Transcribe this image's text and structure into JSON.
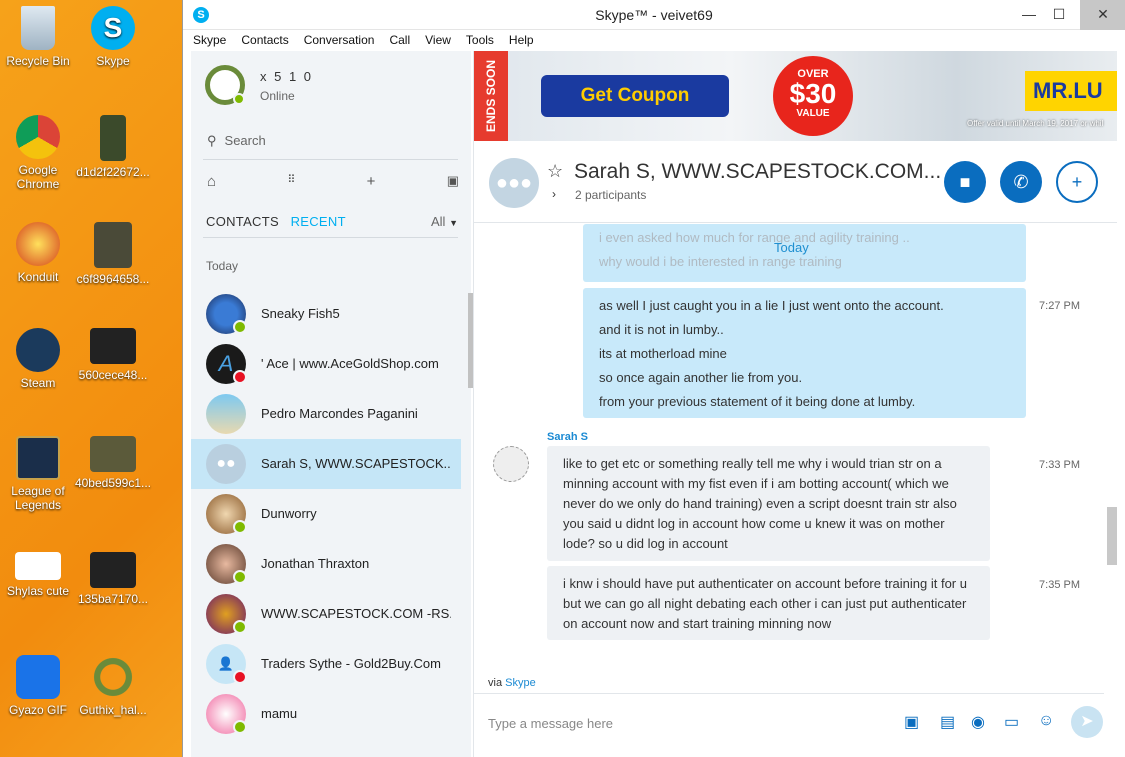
{
  "desktop": {
    "icons": [
      {
        "label": "Recycle Bin"
      },
      {
        "label": "Skype"
      },
      {
        "label": "Google Chrome"
      },
      {
        "label": "d1d2f22672..."
      },
      {
        "label": "Konduit"
      },
      {
        "label": "c6f8964658..."
      },
      {
        "label": "Steam"
      },
      {
        "label": "560cece48..."
      },
      {
        "label": "League of Legends"
      },
      {
        "label": "40bed599c1..."
      },
      {
        "label": "Shylas cute"
      },
      {
        "label": "135ba7170..."
      },
      {
        "label": "Gyazo GIF"
      },
      {
        "label": "Guthix_hal..."
      }
    ]
  },
  "window": {
    "title": "Skype™ - veivet69",
    "minimize": "—",
    "maximize": "☐",
    "close": "✕"
  },
  "menu": [
    "Skype",
    "Contacts",
    "Conversation",
    "Call",
    "View",
    "Tools",
    "Help"
  ],
  "profile": {
    "name": "x 5 1 0",
    "status": "Online"
  },
  "search": {
    "placeholder": "Search"
  },
  "tabs": {
    "contacts": "CONTACTS",
    "recent": "RECENT",
    "filter": "All"
  },
  "section": "Today",
  "contacts": [
    {
      "name": "Sneaky Fish5",
      "presence": "on"
    },
    {
      "name": "' Ace | www.AceGoldShop.com",
      "presence": "off"
    },
    {
      "name": "Pedro Marcondes Paganini",
      "presence": "none"
    },
    {
      "name": "Sarah S, WWW.SCAPESTOCK....",
      "presence": "group"
    },
    {
      "name": "Dunworry",
      "presence": "on"
    },
    {
      "name": "Jonathan Thraxton",
      "presence": "on"
    },
    {
      "name": "WWW.SCAPESTOCK.COM -RS...",
      "presence": "on"
    },
    {
      "name": "Traders Sythe - Gold2Buy.Com",
      "presence": "off"
    },
    {
      "name": "mamu",
      "presence": "on"
    }
  ],
  "ad": {
    "ends": "ENDS SOON",
    "button": "Get Coupon",
    "over": "OVER",
    "amount": "$30",
    "value": "VALUE",
    "brand": "MR.LU",
    "offer": "Offer valid until March 19, 2017 or whil"
  },
  "conversation": {
    "title": "Sarah S, WWW.SCAPESTOCK.COM...",
    "participants": "2 participants",
    "today": "Today",
    "faded_lines": [
      "i even asked how much for range and agility training ..",
      "why would i be interested in range training"
    ],
    "out_lines": [
      "as well I just caught you in a lie I just went onto the account.",
      "and it is not in lumby..",
      "its at motherload mine",
      "so once again another lie from you.",
      "from your previous statement of it being done at lumby."
    ],
    "out_time": "7:27 PM",
    "sender": "Sarah S",
    "in1": "like to get etc or something really tell me why i would trian str on a minning account with my fist even if i am botting account( which we never do we only do hand training) even a script doesnt train str also you said u didnt log in account how come u knew it was on mother lode? so u did log in account",
    "in1_time": "7:33 PM",
    "in2": "i knw i should have put authenticater on account before training it for u but we can go all night debating each other i can just put authenticater on account now and start training minning now",
    "in2_time": "7:35 PM",
    "via_prefix": "via",
    "via_link": "Skype"
  },
  "compose": {
    "placeholder": "Type a message here"
  }
}
